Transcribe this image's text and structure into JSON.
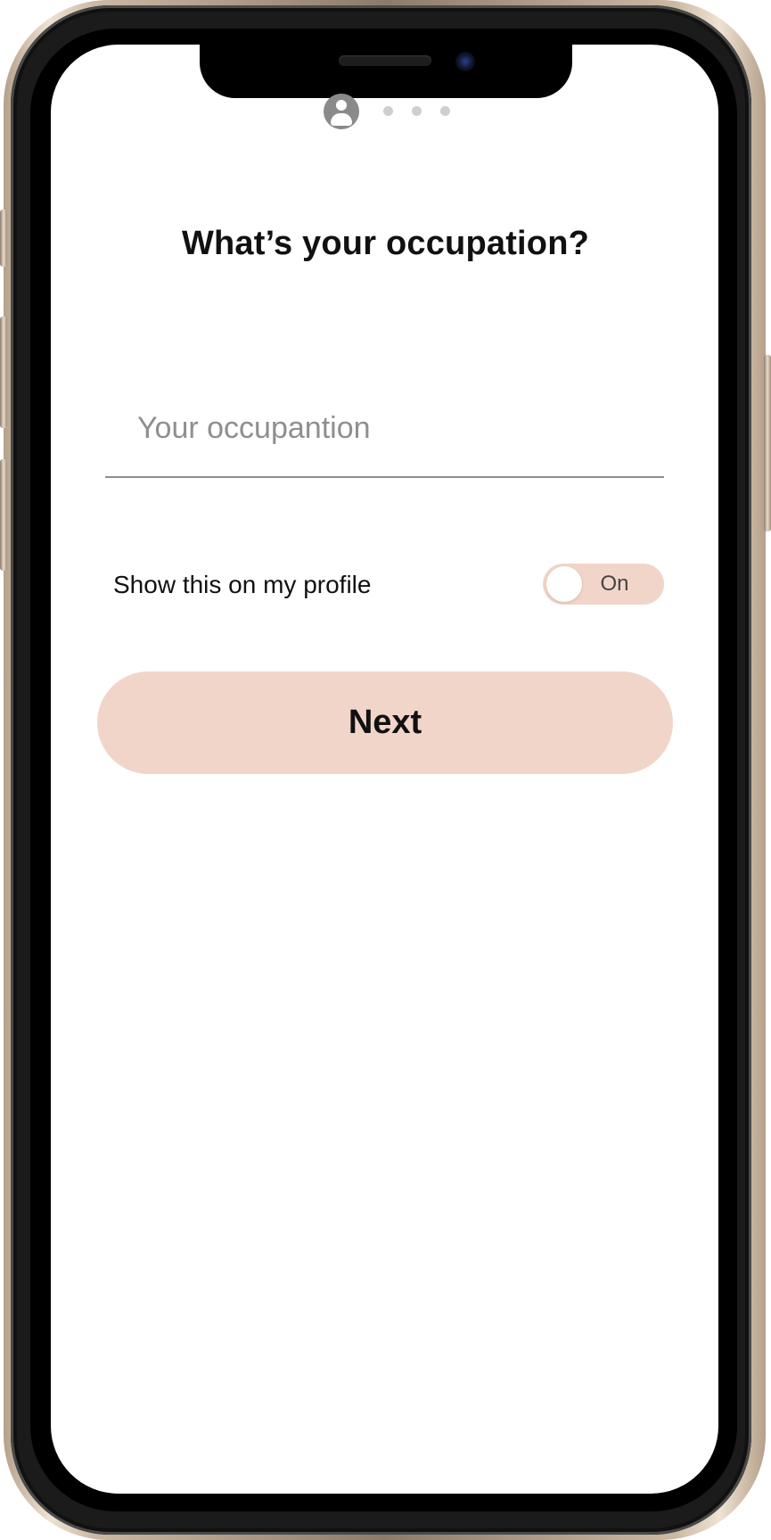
{
  "progress": {
    "current_step_icon": "person-circle-icon",
    "remaining_steps": 3
  },
  "title": "What’s your occupation?",
  "occupation_input": {
    "value": "",
    "placeholder": "Your occupantion"
  },
  "profile_visibility": {
    "label": "Show this on my profile",
    "toggle_text": "On"
  },
  "next_button": {
    "label": "Next"
  },
  "colors": {
    "accent": "#f2d5c9",
    "frame": "#000000"
  }
}
